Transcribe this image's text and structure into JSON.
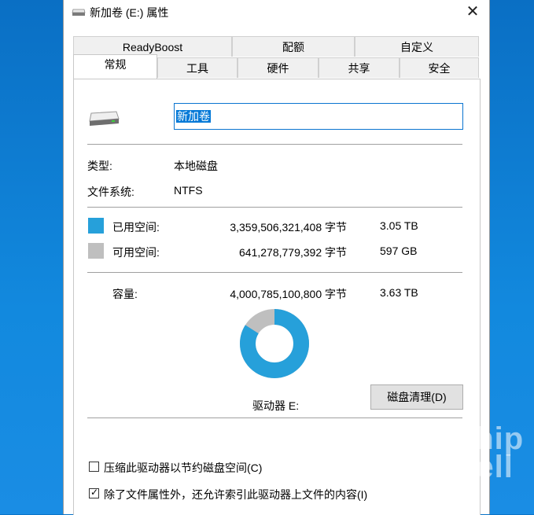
{
  "window": {
    "title": "新加卷 (E:) 属性",
    "close_glyph": "✕"
  },
  "tabs": {
    "row1": [
      "ReadyBoost",
      "配额",
      "自定义"
    ],
    "row2": [
      "常规",
      "工具",
      "硬件",
      "共享",
      "安全"
    ]
  },
  "general": {
    "volume_name": "新加卷",
    "type_label": "类型:",
    "type_value": "本地磁盘",
    "fs_label": "文件系统:",
    "fs_value": "NTFS",
    "used": {
      "label": "已用空间:",
      "bytes": "3,359,506,321,408 字节",
      "human": "3.05 TB",
      "color": "#26a0da",
      "fraction": 0.839
    },
    "free": {
      "label": "可用空间:",
      "bytes": "641,278,779,392 字节",
      "human": "597 GB",
      "color": "#bfbfbf",
      "fraction": 0.161
    },
    "capacity": {
      "label": "容量:",
      "bytes": "4,000,785,100,800 字节",
      "human": "3.63 TB"
    },
    "drive_label": "驱动器 E:",
    "cleanup_button": "磁盘清理(D)"
  },
  "options": {
    "compress": {
      "label": "压缩此驱动器以节约磁盘空间(C)",
      "checked": false
    },
    "index": {
      "label": "除了文件属性外，还允许索引此驱动器上文件的内容(I)",
      "checked": true
    }
  },
  "watermark": {
    "text": "www.chiphell.com",
    "logo": "chip hell"
  }
}
